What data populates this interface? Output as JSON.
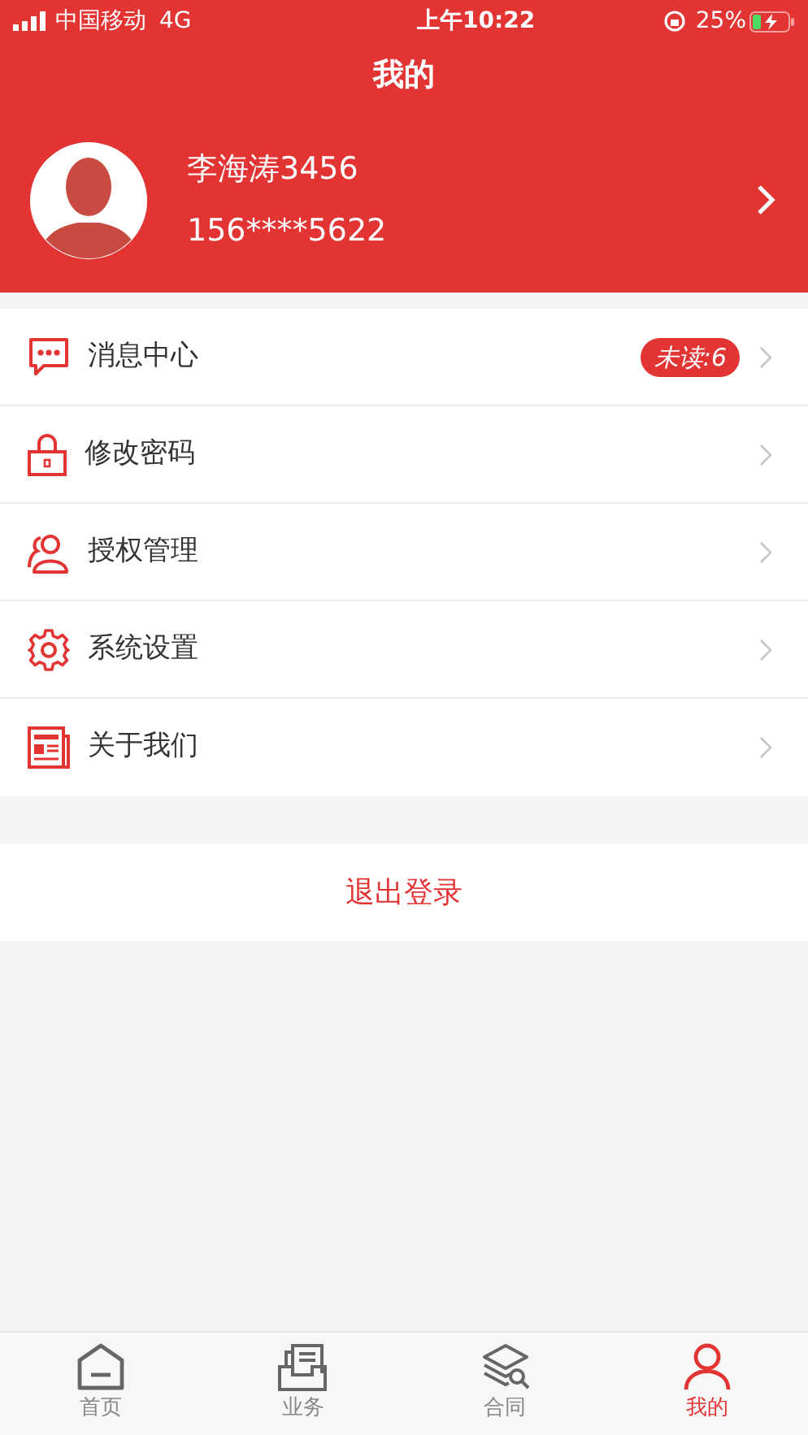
{
  "status_bar": {
    "carrier": "中国移动",
    "network": "4G",
    "time": "上午10:22",
    "battery": "25%"
  },
  "header": {
    "title": "我的"
  },
  "profile": {
    "name": "李海涛3456",
    "phone": "156****5622"
  },
  "menu": [
    {
      "label": "消息中心",
      "badge": "未读:6"
    },
    {
      "label": "修改密码"
    },
    {
      "label": "授权管理"
    },
    {
      "label": "系统设置"
    },
    {
      "label": "关于我们"
    }
  ],
  "logout": {
    "label": "退出登录"
  },
  "tab_bar": [
    {
      "label": "首页",
      "selected": false
    },
    {
      "label": "业务",
      "selected": false
    },
    {
      "label": "合同",
      "selected": false
    },
    {
      "label": "我的",
      "selected": true
    }
  ]
}
